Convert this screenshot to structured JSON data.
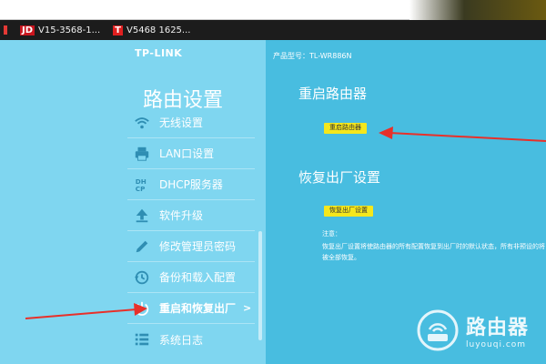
{
  "bookmarks": [
    {
      "icon": "jd-logo-icon",
      "logo": "JD",
      "label": "V15-3568-1..."
    },
    {
      "icon": "t-logo-icon",
      "logo": "T",
      "label": "V5468 1625..."
    }
  ],
  "sidebar": {
    "brand": "TP-LINK",
    "title": "路由设置",
    "items": [
      {
        "label": "无线设置",
        "icon": "wifi-icon"
      },
      {
        "label": "LAN口设置",
        "icon": "printer-icon"
      },
      {
        "label": "DHCP服务器",
        "icon": "dhcp-icon",
        "icon_text": "DH\nCP"
      },
      {
        "label": "软件升级",
        "icon": "upload-icon"
      },
      {
        "label": "修改管理员密码",
        "icon": "pencil-icon"
      },
      {
        "label": "备份和载入配置",
        "icon": "history-icon"
      },
      {
        "label": "重启和恢复出厂",
        "icon": "power-icon",
        "chevron": ">",
        "active": true
      },
      {
        "label": "系统日志",
        "icon": "list-icon"
      }
    ]
  },
  "main": {
    "model": "产品型号：TL-WR886N",
    "reboot": {
      "title": "重启路由器",
      "button": "重启路由器"
    },
    "factory": {
      "title": "恢复出厂设置",
      "button": "恢复出厂设置",
      "note_label": "注意：",
      "note_text": "恢复出厂设置将使路由器的所有配置恢复到出厂时的默认状态，所有非预设的将被全部恢复。"
    }
  },
  "watermark": {
    "name": "路由器",
    "url": "luyouqi.com"
  },
  "colors": {
    "left_bg": "#7fd6f0",
    "right_bg": "#48bde0",
    "button_yellow": "#f5e71c",
    "arrow_red": "#e8302a"
  }
}
